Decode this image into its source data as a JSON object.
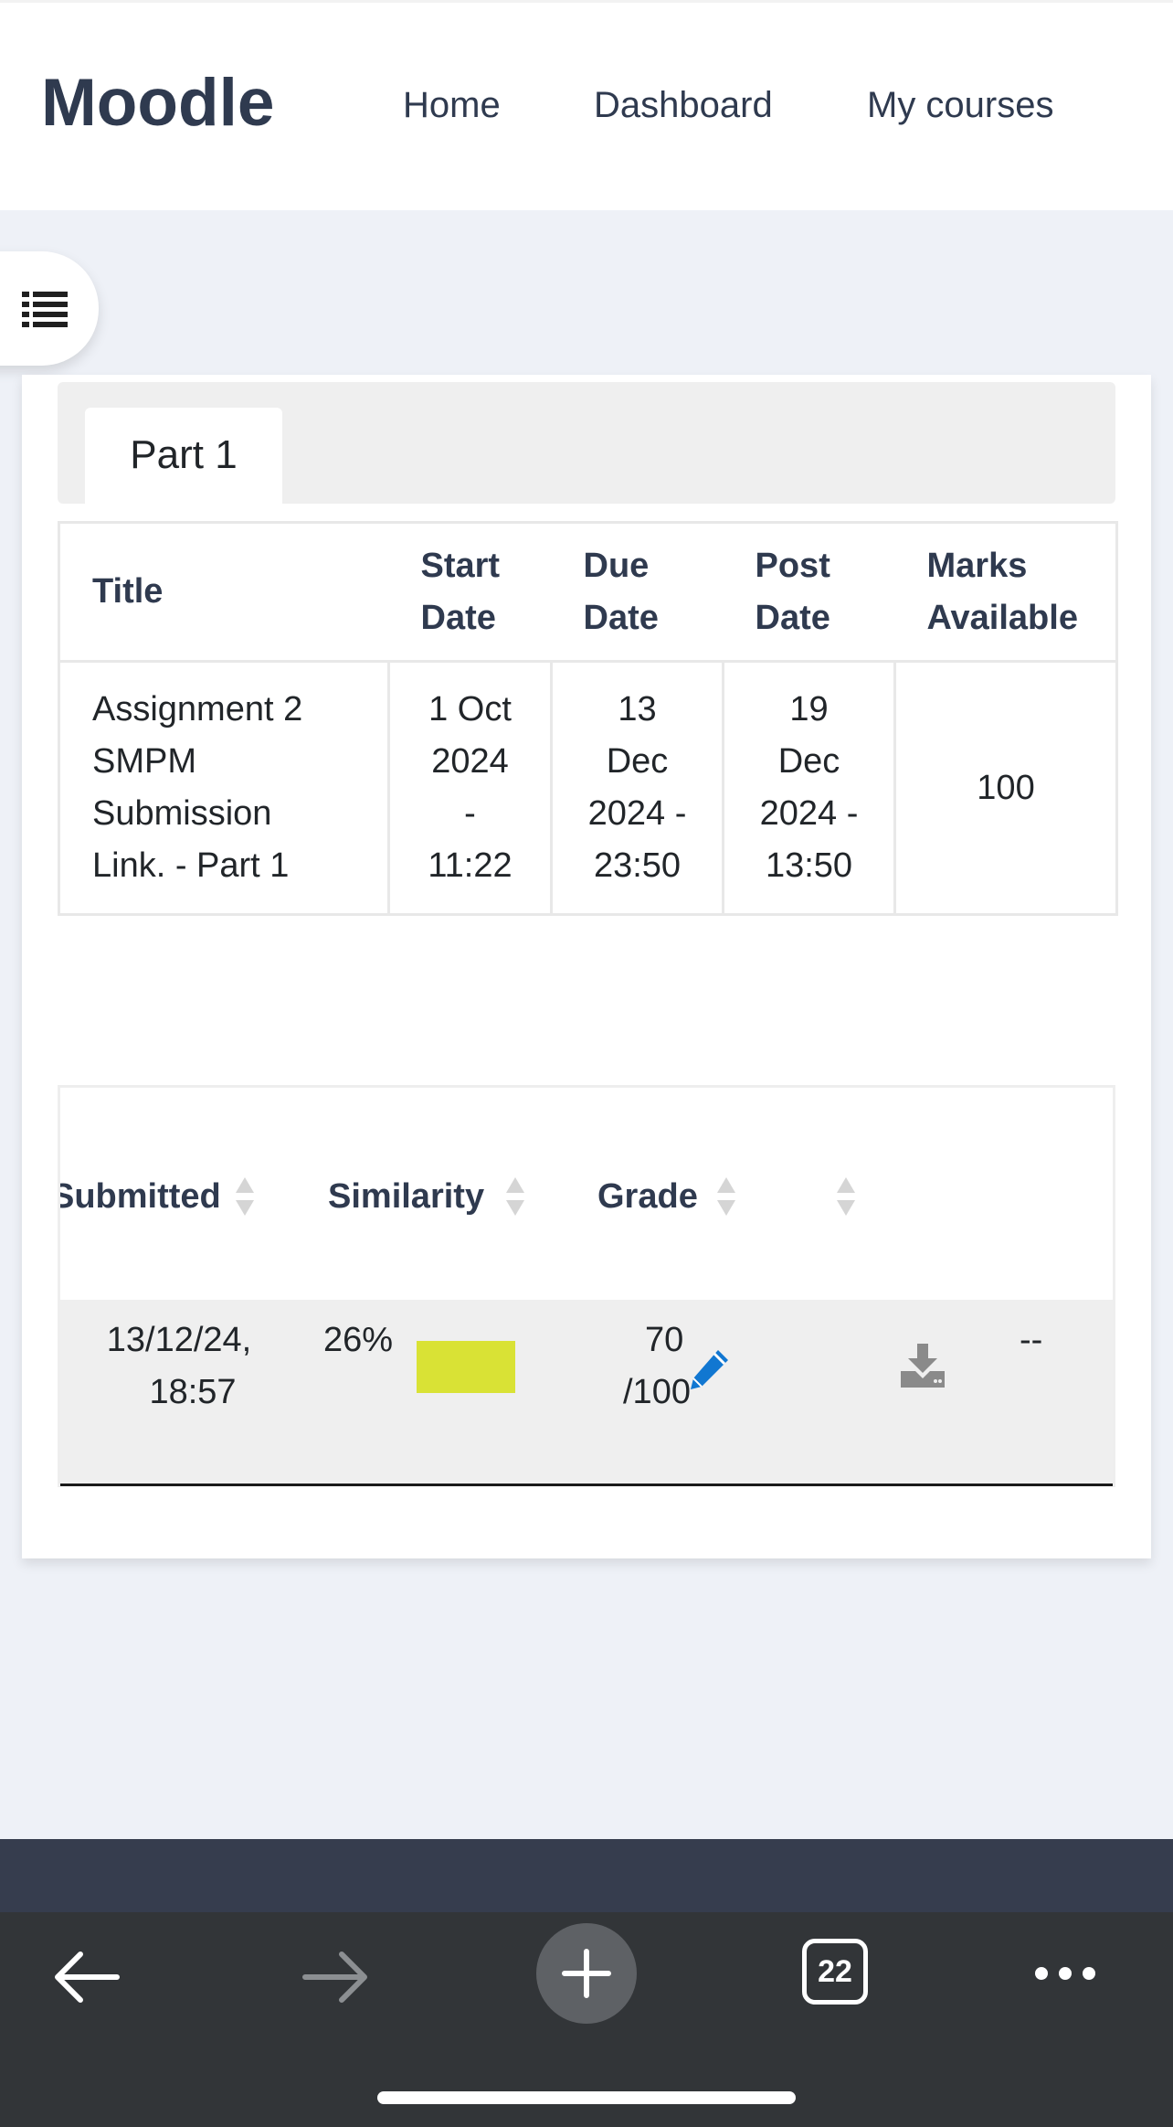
{
  "navbar": {
    "brand": "Moodle",
    "links": [
      "Home",
      "Dashboard",
      "My courses"
    ]
  },
  "tabs": [
    {
      "label": "Part 1",
      "active": true
    }
  ],
  "parts_table": {
    "headers": {
      "title": "Title",
      "start_line1": "Start",
      "start_line2": "Date",
      "due_line1": "Due",
      "due_line2": "Date",
      "post_line1": "Post",
      "post_line2": "Date",
      "marks_line1": "Marks",
      "marks_line2": "Available"
    },
    "row": {
      "title_lines": [
        "Assignment 2",
        "SMPM",
        "Submission",
        "Link. - Part 1"
      ],
      "start_lines": [
        "1 Oct",
        "2024",
        "-",
        "11:22"
      ],
      "due_lines": [
        "13",
        "Dec",
        "2024 -",
        "23:50"
      ],
      "post_lines": [
        "19",
        "Dec",
        "2024 -",
        "13:50"
      ],
      "marks": "100"
    }
  },
  "submissions_table": {
    "headers": {
      "submitted": "Submitted",
      "similarity": "Similarity",
      "grade": "Grade"
    },
    "row": {
      "submitted_line1": "13/12/24,",
      "submitted_line2": "18:57",
      "similarity": "26%",
      "similarity_color": "#d9e235",
      "grade_value": "70",
      "grade_total": "/100",
      "extra": "--"
    }
  },
  "browser": {
    "tab_count": "22"
  },
  "icons": {
    "drawer": "list-icon",
    "edit": "pencil-icon",
    "download": "download-icon",
    "sort": "sort-icon"
  },
  "colors": {
    "brand": "#2f3a4f",
    "edit_icon": "#1177d1",
    "page_bg": "#eef1f7"
  }
}
